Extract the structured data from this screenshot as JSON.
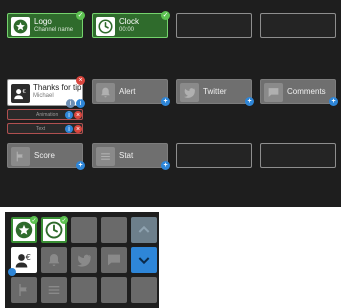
{
  "widgets": {
    "logo": {
      "title": "Logo",
      "subtitle": "Channel name"
    },
    "clock": {
      "title": "Clock",
      "subtitle": "00:00"
    },
    "tip": {
      "title": "Thanks for tip",
      "subtitle": "Michael",
      "rows": [
        "Animation",
        "Text"
      ]
    },
    "alert": {
      "title": "Alert"
    },
    "twitter": {
      "title": "Twitter"
    },
    "comments": {
      "title": "Comments"
    },
    "score": {
      "title": "Score"
    },
    "stat": {
      "title": "Stat"
    }
  },
  "badges": {
    "check": "✓",
    "plus": "+",
    "close": "×",
    "info": "i"
  },
  "icons": {
    "logo": "star-icon",
    "clock": "clock-icon",
    "tip": "user-euro-icon",
    "alert": "bell-icon",
    "twitter": "twitter-bird-icon",
    "comments": "comment-icon",
    "score": "flag-icon",
    "stat": "list-icon",
    "nav_up": "chevron-up-icon",
    "nav_down": "chevron-down-icon"
  },
  "colors": {
    "active_green": "#2f6b2c",
    "accent_blue": "#2e86d8",
    "close_red": "#d9453d",
    "panel": "#1e1e1e"
  }
}
